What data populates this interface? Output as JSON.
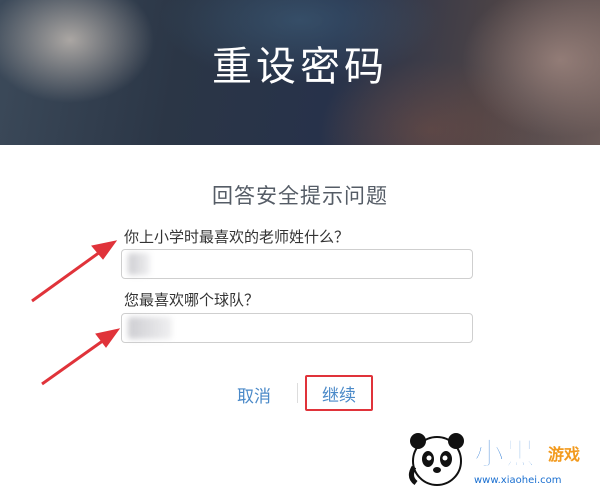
{
  "hero": {
    "title": "重设密码"
  },
  "form": {
    "heading": "回答安全提示问题",
    "questions": [
      {
        "label": "你上小学时最喜欢的老师姓什么？",
        "answer": ""
      },
      {
        "label": "您最喜欢哪个球队？",
        "answer": ""
      }
    ]
  },
  "actions": {
    "cancel_label": "取消",
    "continue_label": "继续"
  },
  "annotations": {
    "arrow_color": "#e0333a",
    "highlight_color": "#e0333a"
  },
  "watermark": {
    "brand": "小黑",
    "brand_sub": "游戏",
    "url": "www.xiaohei.com"
  },
  "colors": {
    "link": "#4a89c8",
    "text": "#333333",
    "heading": "#555c66"
  }
}
